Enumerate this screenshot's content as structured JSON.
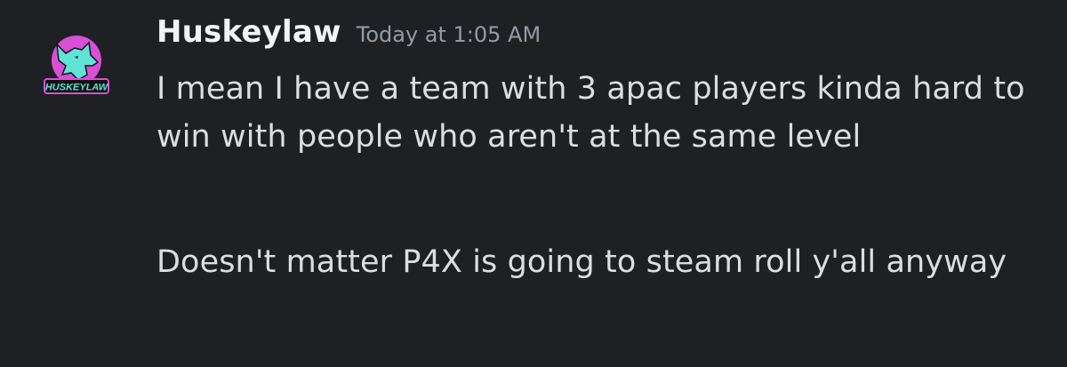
{
  "message_group": {
    "author": {
      "username": "Huskeylaw",
      "avatar_text": "HUSKEYLAW"
    },
    "timestamp": "Today at 1:05 AM",
    "messages": [
      {
        "text": "I mean I have a team with 3 apac players kinda hard to win with people who aren't at the same level"
      },
      {
        "text": "Doesn't matter P4X is going to steam roll y'all anyway"
      }
    ]
  },
  "colors": {
    "background": "#1f2023",
    "username": "#f2f3f5",
    "timestamp": "#949ba4",
    "message_text": "#dbdee1",
    "avatar_pink": "#d94fd6",
    "avatar_cyan": "#5fe3d4"
  }
}
